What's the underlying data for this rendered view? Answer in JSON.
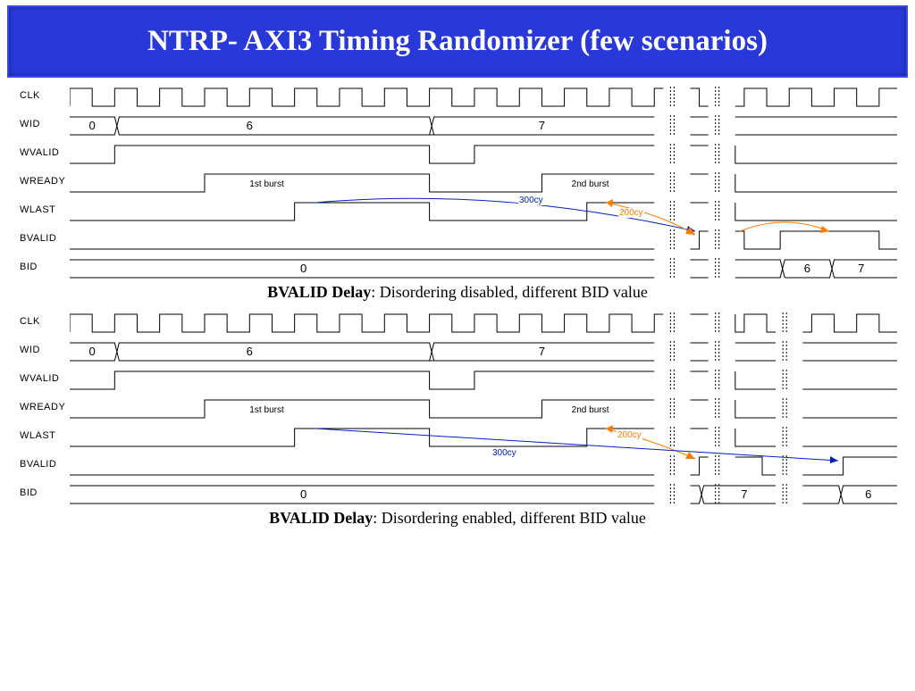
{
  "title": "NTRP- AXI3 Timing Randomizer (few scenarios)",
  "signals": [
    "CLK",
    "WID",
    "WVALID",
    "WREADY",
    "WLAST",
    "BVALID",
    "BID"
  ],
  "diagrams": [
    {
      "caption_bold": "BVALID Delay",
      "caption_rest": ": Disordering disabled, different BID value",
      "wid_values": [
        "0",
        "6",
        "7"
      ],
      "wready_labels": [
        "1st burst",
        "2nd burst"
      ],
      "delay_labels": [
        "300cy",
        "200cy"
      ],
      "bid_values": [
        "0",
        "6",
        "7"
      ]
    },
    {
      "caption_bold": "BVALID Delay",
      "caption_rest": ": Disordering enabled, different BID value",
      "wid_values": [
        "0",
        "6",
        "7"
      ],
      "wready_labels": [
        "1st burst",
        "2nd burst"
      ],
      "delay_labels": [
        "200cy",
        "300cy"
      ],
      "bid_values": [
        "0",
        "7",
        "6"
      ]
    }
  ]
}
